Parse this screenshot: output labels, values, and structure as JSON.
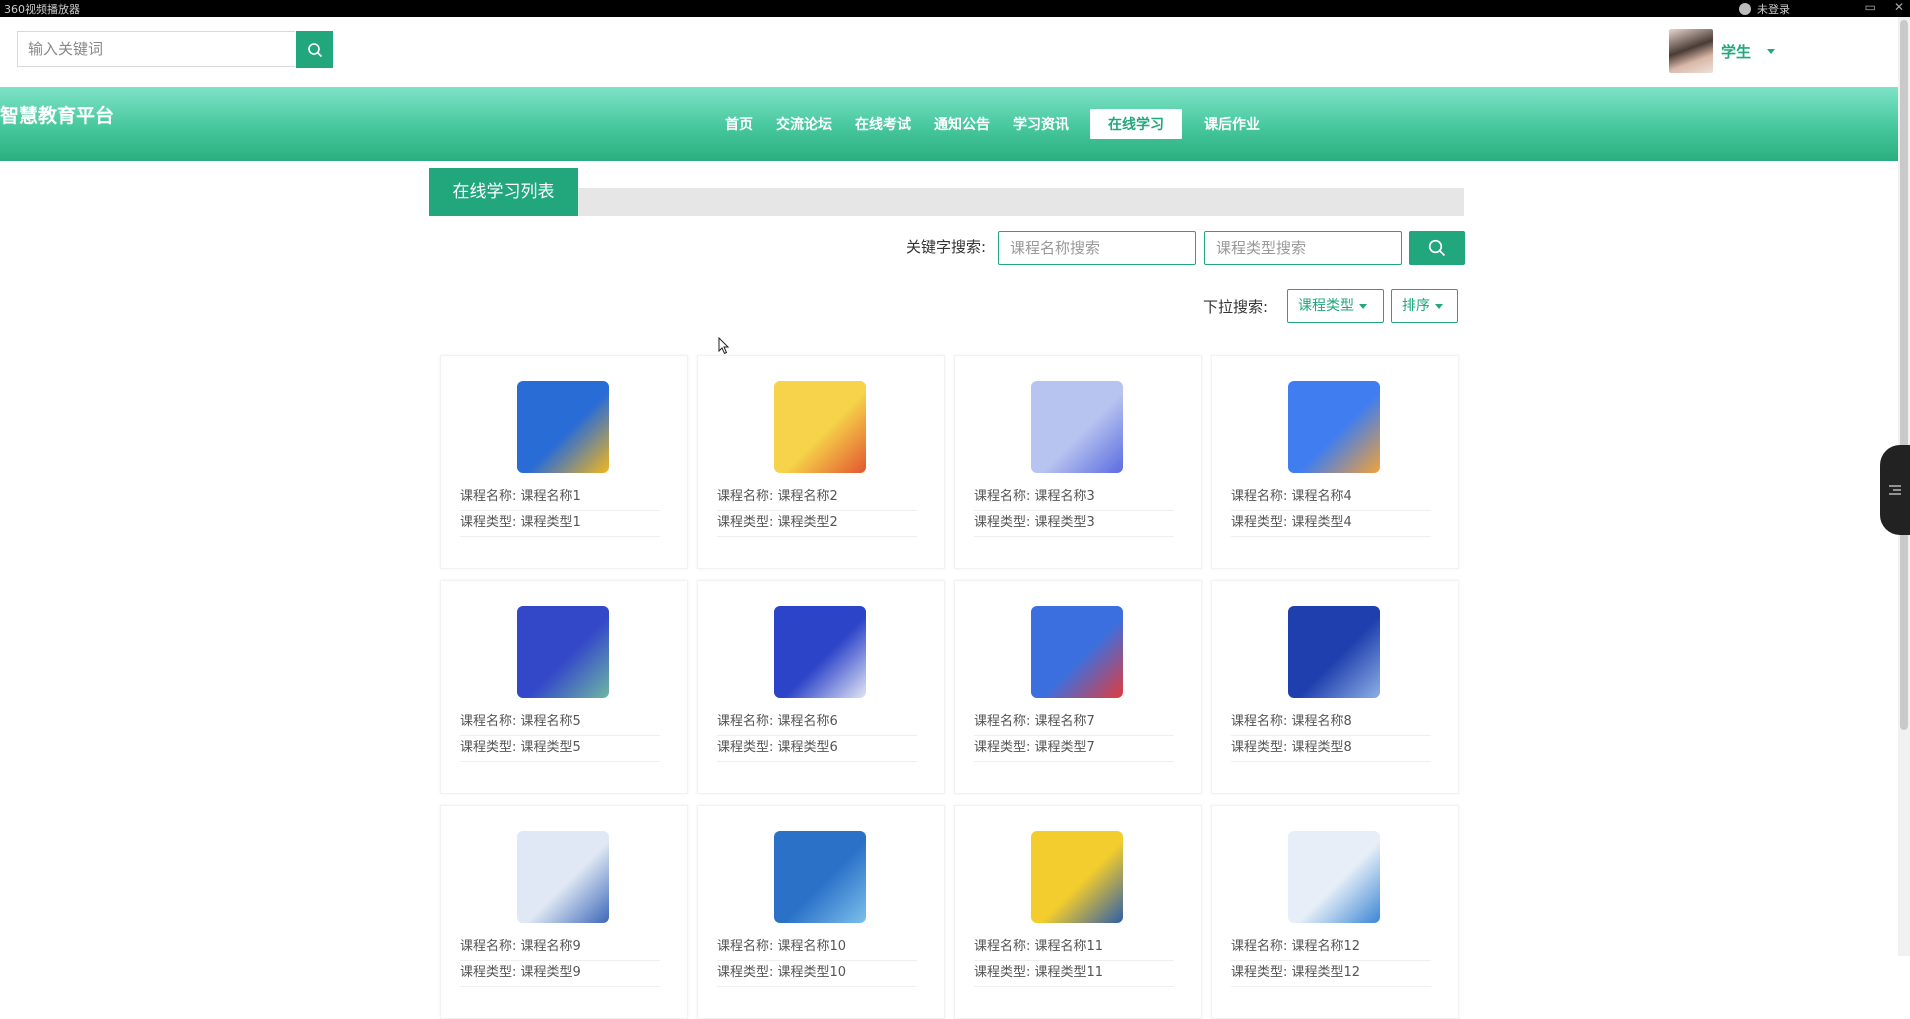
{
  "window": {
    "title": "360视频播放器",
    "login": "未登录"
  },
  "header": {
    "search_placeholder": "输入关键词",
    "user_name": "学生"
  },
  "brand": "智慧教育平台",
  "nav": {
    "items": [
      "首页",
      "交流论坛",
      "在线考试",
      "通知公告",
      "学习资讯",
      "在线学习",
      "课后作业"
    ],
    "active": "在线学习"
  },
  "section": {
    "title": "在线学习列表"
  },
  "filters": {
    "keyword_label": "关键字搜索:",
    "name_placeholder": "课程名称搜索",
    "type_placeholder": "课程类型搜索",
    "dropdown_label": "下拉搜索:",
    "type_dropdown": "课程类型",
    "sort_dropdown": "排序"
  },
  "courses": [
    {
      "name_label": "课程名称:",
      "name": "课程名称1",
      "type_label": "课程类型:",
      "type": "课程类型1",
      "thumb_colors": [
        "#2a6cd6",
        "#f2b71e"
      ]
    },
    {
      "name_label": "课程名称:",
      "name": "课程名称2",
      "type_label": "课程类型:",
      "type": "课程类型2",
      "thumb_colors": [
        "#f6d34a",
        "#e2552f"
      ]
    },
    {
      "name_label": "课程名称:",
      "name": "课程名称3",
      "type_label": "课程类型:",
      "type": "课程类型3",
      "thumb_colors": [
        "#b8c4f0",
        "#5b6be0"
      ]
    },
    {
      "name_label": "课程名称:",
      "name": "课程名称4",
      "type_label": "课程类型:",
      "type": "课程类型4",
      "thumb_colors": [
        "#3f7df0",
        "#f2a23a"
      ]
    },
    {
      "name_label": "课程名称:",
      "name": "课程名称5",
      "type_label": "课程类型:",
      "type": "课程类型5",
      "thumb_colors": [
        "#3347c9",
        "#6fb7a3"
      ]
    },
    {
      "name_label": "课程名称:",
      "name": "课程名称6",
      "type_label": "课程类型:",
      "type": "课程类型6",
      "thumb_colors": [
        "#2c44c8",
        "#e2e6f5"
      ]
    },
    {
      "name_label": "课程名称:",
      "name": "课程名称7",
      "type_label": "课程类型:",
      "type": "课程类型7",
      "thumb_colors": [
        "#3b6fe0",
        "#e23b3b"
      ]
    },
    {
      "name_label": "课程名称:",
      "name": "课程名称8",
      "type_label": "课程类型:",
      "type": "课程类型8",
      "thumb_colors": [
        "#1f3fae",
        "#8eb0e6"
      ]
    },
    {
      "name_label": "课程名称:",
      "name": "课程名称9",
      "type_label": "课程类型:",
      "type": "课程类型9",
      "thumb_colors": [
        "#dfe8f4",
        "#3d67b8"
      ]
    },
    {
      "name_label": "课程名称:",
      "name": "课程名称10",
      "type_label": "课程类型:",
      "type": "课程类型10",
      "thumb_colors": [
        "#2b71c8",
        "#7cc0ec"
      ]
    },
    {
      "name_label": "课程名称:",
      "name": "课程名称11",
      "type_label": "课程类型:",
      "type": "课程类型11",
      "thumb_colors": [
        "#f3cd2d",
        "#2e5ea8"
      ]
    },
    {
      "name_label": "课程名称:",
      "name": "课程名称12",
      "type_label": "课程类型:",
      "type": "课程类型12",
      "thumb_colors": [
        "#e7eef8",
        "#3b86d4"
      ]
    }
  ],
  "colors": {
    "accent": "#21a77b",
    "banner_light": "#7ee3c7",
    "banner_dark": "#2aae7f"
  }
}
